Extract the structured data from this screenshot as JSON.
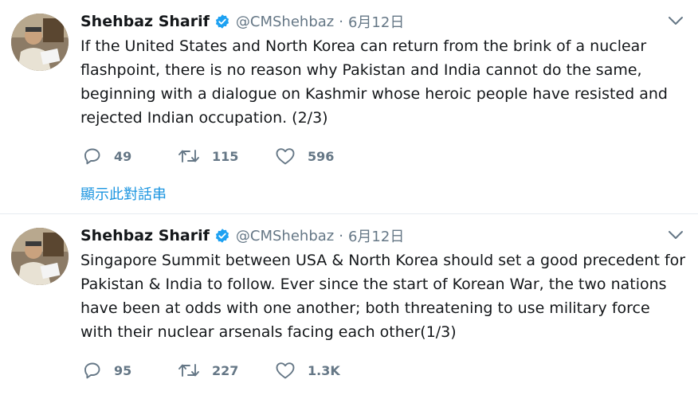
{
  "tweets": [
    {
      "author_name": "Shehbaz Sharif",
      "handle": "@CMShehbaz",
      "separator": "·",
      "date": "6月12日",
      "text": "If the United States and North Korea can return from the brink of a nuclear flashpoint, there is no reason why Pakistan and India cannot do the same, beginning with a dialogue on Kashmir whose heroic people have resisted and rejected Indian occupation. (2/3)",
      "replies": "49",
      "retweets": "115",
      "likes": "596",
      "thread_link": "顯示此對話串"
    },
    {
      "author_name": "Shehbaz Sharif",
      "handle": "@CMShehbaz",
      "separator": "·",
      "date": "6月12日",
      "text": "Singapore Summit between USA & North Korea should set a good precedent for Pakistan & India to follow. Ever since the start of Korean War, the two nations have been at odds with one another; both threatening to use military force with their nuclear arsenals facing each other(1/3)",
      "replies": "95",
      "retweets": "227",
      "likes": "1.3K"
    }
  ],
  "colors": {
    "verified": "#1da1f2",
    "secondary_text": "#657786",
    "link": "#1b95e0",
    "divider": "#e6ecf0"
  },
  "icons": [
    "verified-badge-icon",
    "chevron-down-icon",
    "reply-icon",
    "retweet-icon",
    "like-icon"
  ]
}
